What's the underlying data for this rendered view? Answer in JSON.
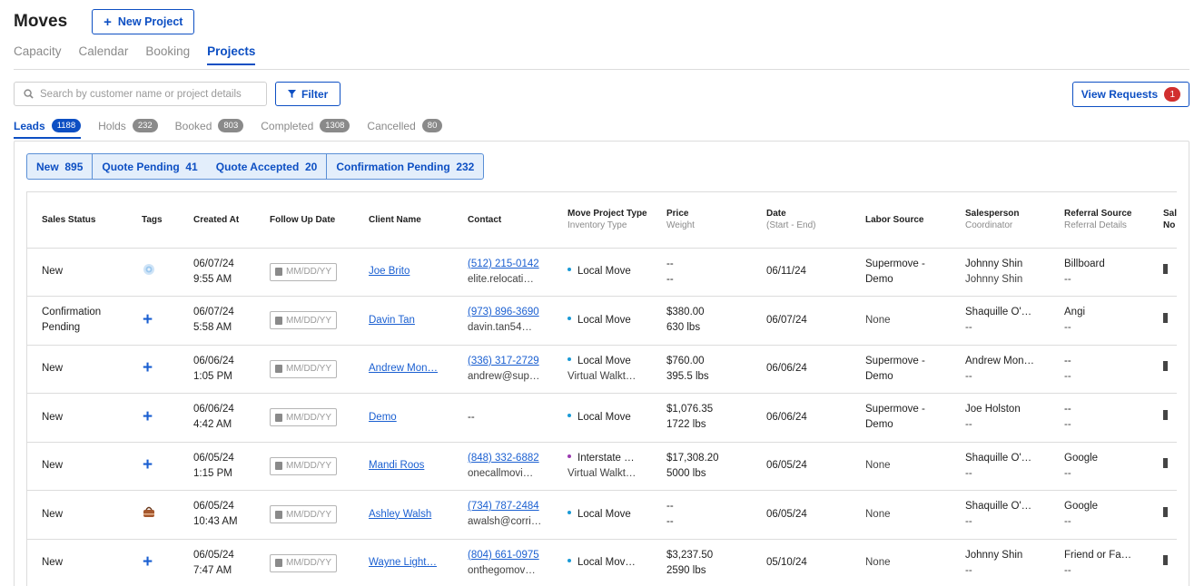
{
  "app": {
    "title": "Moves",
    "new_project_label": "New Project"
  },
  "nav": {
    "tabs": [
      "Capacity",
      "Calendar",
      "Booking",
      "Projects"
    ],
    "active": "Projects"
  },
  "toolbar": {
    "search_placeholder": "Search by customer name or project details",
    "filter_label": "Filter",
    "view_requests_label": "View Requests",
    "view_requests_count": "1"
  },
  "subtabs": [
    {
      "label": "Leads",
      "count": "1188"
    },
    {
      "label": "Holds",
      "count": "232"
    },
    {
      "label": "Booked",
      "count": "803"
    },
    {
      "label": "Completed",
      "count": "1308"
    },
    {
      "label": "Cancelled",
      "count": "80"
    }
  ],
  "status_filters": {
    "new": "New  895",
    "quote_pending": "Quote Pending  41",
    "quote_accepted": "Quote Accepted  20",
    "confirmation_pending": "Confirmation Pending  232"
  },
  "table": {
    "headers": {
      "sales_status": "Sales Status",
      "tags": "Tags",
      "created_at": "Created At",
      "follow_up": "Follow Up Date",
      "client_name": "Client Name",
      "contact": "Contact",
      "move_type": "Move Project Type",
      "move_type_sub": "Inventory Type",
      "price": "Price",
      "price_sub": "Weight",
      "date": "Date",
      "date_sub": "(Start - End)",
      "labor": "Labor Source",
      "salesperson": "Salesperson",
      "salesperson_sub": "Coordinator",
      "referral": "Referral Source",
      "referral_sub": "Referral Details",
      "cut1": "Sal",
      "cut2": "No"
    },
    "date_placeholder": "MM/DD/YY",
    "rows": [
      {
        "status": "New",
        "tag": "icon",
        "created_date": "06/07/24",
        "created_time": "9:55 AM",
        "client": "Joe Brito",
        "phone": "(512) 215-0142",
        "email": "elite.relocati…",
        "move_type": "Local Move",
        "inventory": "",
        "price": "--",
        "weight": "--",
        "date": "06/11/24",
        "labor": "Supermove - Demo",
        "salesperson": "Johnny Shin",
        "coordinator": "Johnny Shin",
        "referral": "Billboard",
        "referral_details": "--"
      },
      {
        "status": "Confirmation Pending",
        "tag": "plus",
        "created_date": "06/07/24",
        "created_time": "5:58 AM",
        "client": "Davin Tan",
        "phone": "(973) 896-3690",
        "email": "davin.tan54…",
        "move_type": "Local Move",
        "inventory": "",
        "price": "$380.00",
        "weight": "630 lbs",
        "date": "06/07/24",
        "labor": "None",
        "salesperson": "Shaquille O'…",
        "coordinator": "--",
        "referral": "Angi",
        "referral_details": "--"
      },
      {
        "status": "New",
        "tag": "plus",
        "created_date": "06/06/24",
        "created_time": "1:05 PM",
        "client": "Andrew Mon…",
        "phone": "(336) 317-2729",
        "email": "andrew@sup…",
        "move_type": "Local Move",
        "inventory": "Virtual Walkt…",
        "price": "$760.00",
        "weight": "395.5 lbs",
        "date": "06/06/24",
        "labor": "Supermove - Demo",
        "salesperson": "Andrew Mon…",
        "coordinator": "--",
        "referral": "--",
        "referral_details": "--"
      },
      {
        "status": "New",
        "tag": "plus",
        "created_date": "06/06/24",
        "created_time": "4:42 AM",
        "client": "Demo",
        "phone": "",
        "email": "",
        "contact_plain": "--",
        "move_type": "Local Move",
        "inventory": "",
        "price": "$1,076.35",
        "weight": "1722 lbs",
        "date": "06/06/24",
        "labor": "Supermove - Demo",
        "salesperson": "Joe Holston",
        "coordinator": "--",
        "referral": "--",
        "referral_details": "--"
      },
      {
        "status": "New",
        "tag": "plus",
        "created_date": "06/05/24",
        "created_time": "1:15 PM",
        "client": "Mandi Roos",
        "phone": "(848) 332-6882",
        "email": "onecallmovi…",
        "move_type": "Interstate …",
        "inventory": "Virtual Walkt…",
        "price": "$17,308.20",
        "weight": "5000 lbs",
        "date": "06/05/24",
        "labor": "None",
        "salesperson": "Shaquille O'…",
        "coordinator": "--",
        "referral": "Google",
        "referral_details": "--"
      },
      {
        "status": "New",
        "tag": "bag",
        "created_date": "06/05/24",
        "created_time": "10:43 AM",
        "client": "Ashley Walsh",
        "phone": "(734) 787-2484",
        "email": "awalsh@corri…",
        "move_type": "Local Move",
        "inventory": "",
        "price": "--",
        "weight": "--",
        "date": "06/05/24",
        "labor": "None",
        "salesperson": "Shaquille O'…",
        "coordinator": "--",
        "referral": "Google",
        "referral_details": "--"
      },
      {
        "status": "New",
        "tag": "plus",
        "created_date": "06/05/24",
        "created_time": "7:47 AM",
        "client": "Wayne Light…",
        "phone": "(804) 661-0975",
        "email": "onthegomov…",
        "move_type": "Local Mov…",
        "inventory": "",
        "price": "$3,237.50",
        "weight": "2590 lbs",
        "date": "05/10/24",
        "labor": "None",
        "salesperson": "Johnny Shin",
        "coordinator": "--",
        "referral": "Friend or Fa…",
        "referral_details": "--"
      }
    ]
  },
  "colors": {
    "accent": "#0d4fc3",
    "badge_red": "#d12f2f",
    "interstate_dot": "#9b3bb0",
    "local_dot": "#1a9ad6"
  }
}
